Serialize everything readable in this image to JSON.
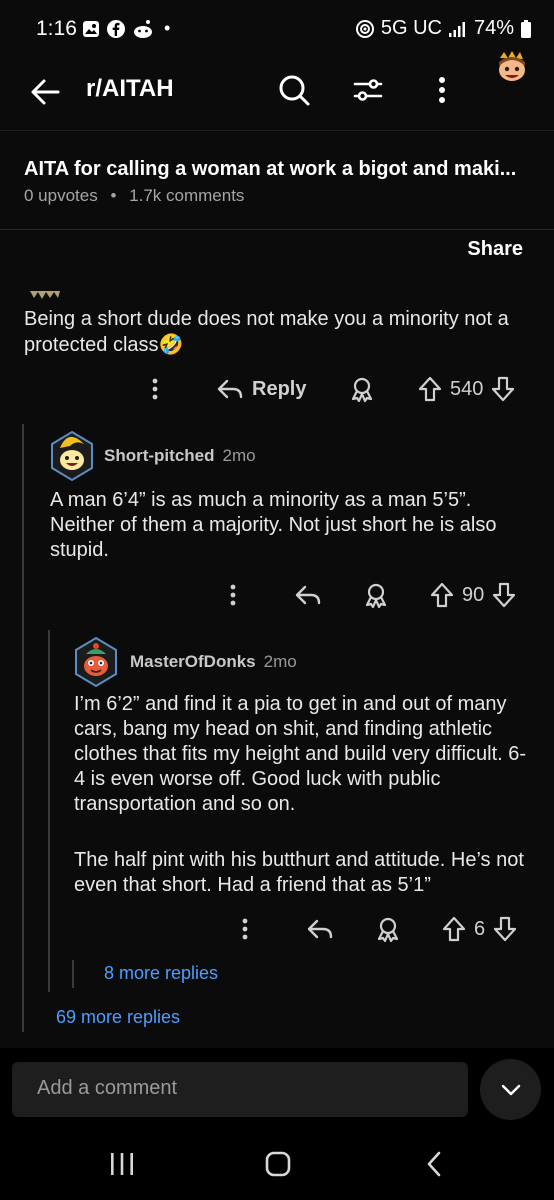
{
  "status": {
    "time": "1:16",
    "dot": "•",
    "network": "5G UC",
    "battery": "74%"
  },
  "topbar": {
    "subreddit": "r/AITAH"
  },
  "post": {
    "title": "AITA for calling a woman at work a bigot and maki...",
    "upvotes": "0 upvotes",
    "separator": "•",
    "comments": "1.7k comments",
    "share": "Share"
  },
  "comments": [
    {
      "body": "Being a short dude does not make you a minority not a protected class",
      "emoji": "🤣",
      "reply": "Reply",
      "score": "540"
    },
    {
      "author": "Short-pitched",
      "age": "2mo",
      "body": "A man 6’4” is as much a minority as a man 5’5”. Neither of them a majority. Not just short he is also stupid.",
      "score": "90"
    },
    {
      "author": "MasterOfDonks",
      "age": "2mo",
      "body": "I’m 6’2” and find it a pia to get in and out of many cars, bang my head on shit, and finding athletic clothes that fits my height and build very difficult. 6-4 is even worse off. Good luck with public transportation and so on.",
      "body2": "The half pint with his butthurt and attitude. He’s not even that short. Had a friend that as 5’1”",
      "score": "6"
    }
  ],
  "more": {
    "nested": "8 more replies",
    "thread": "69 more replies"
  },
  "composer": {
    "placeholder": "Add a comment"
  },
  "colors": {
    "background": "#0b0b0b",
    "link": "#4a9fff",
    "muted": "#9a9a9a",
    "input": "#1e1e1e"
  },
  "icons": [
    "back-arrow-icon",
    "search-icon",
    "filter-icon",
    "more-vert-icon",
    "reply-icon",
    "award-icon",
    "upvote-icon",
    "downvote-icon",
    "chevron-down-icon"
  ]
}
